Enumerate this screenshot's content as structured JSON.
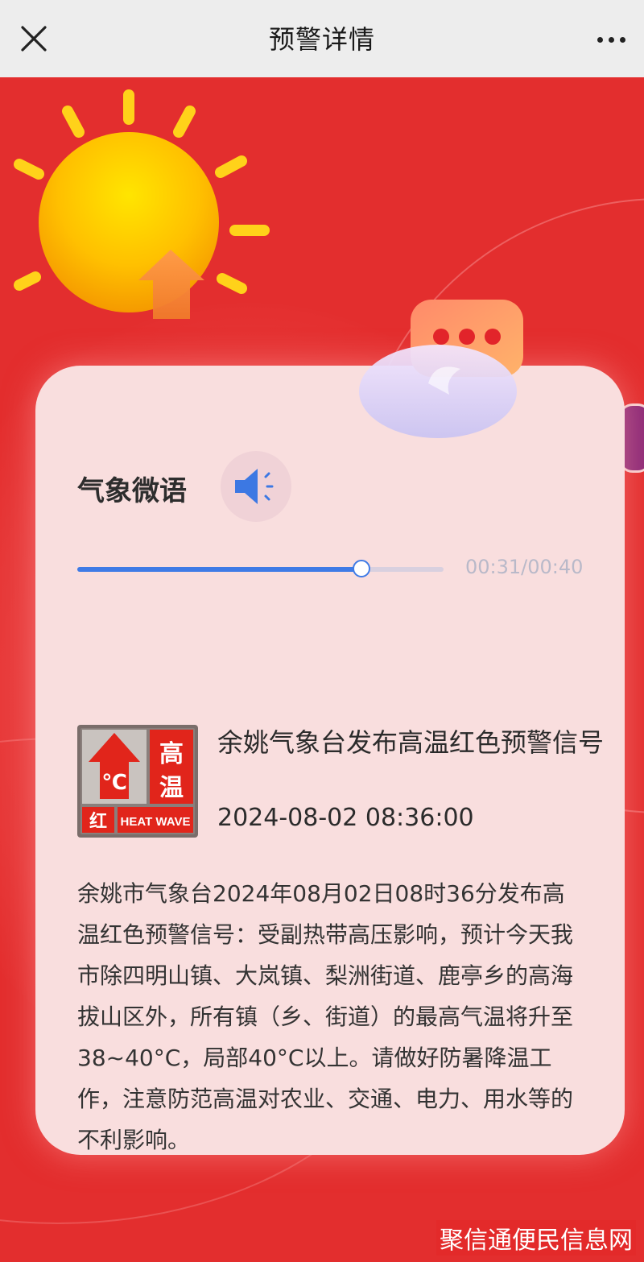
{
  "header": {
    "title": "预警详情"
  },
  "audio": {
    "title": "气象微语",
    "progress": 0.775,
    "time_readout": "00:31/00:40"
  },
  "warning": {
    "icon": {
      "top_right": "高温",
      "bottom_left": "红",
      "bottom_right": "HEAT WAVE",
      "symbol": "℃"
    },
    "title": "余姚气象台发布高温红色预警信号",
    "time": "2024-08-02 08:36:00",
    "body": "余姚市气象台2024年08月02日08时36分发布高温红色预警信号：受副热带高压影响，预计今天我市除四明山镇、大岚镇、梨洲街道、鹿亭乡的高海拔山区外，所有镇（乡、街道）的最高气温将升至38~40°C，局部40°C以上。请做好防暑降温工作，注意防范高温对农业、交通、电力、用水等的不利影响。"
  },
  "watermark": "聚信通便民信息网",
  "colors": {
    "background": "#e32e2e",
    "card": "#f9dede",
    "accent": "#3f7be6"
  }
}
